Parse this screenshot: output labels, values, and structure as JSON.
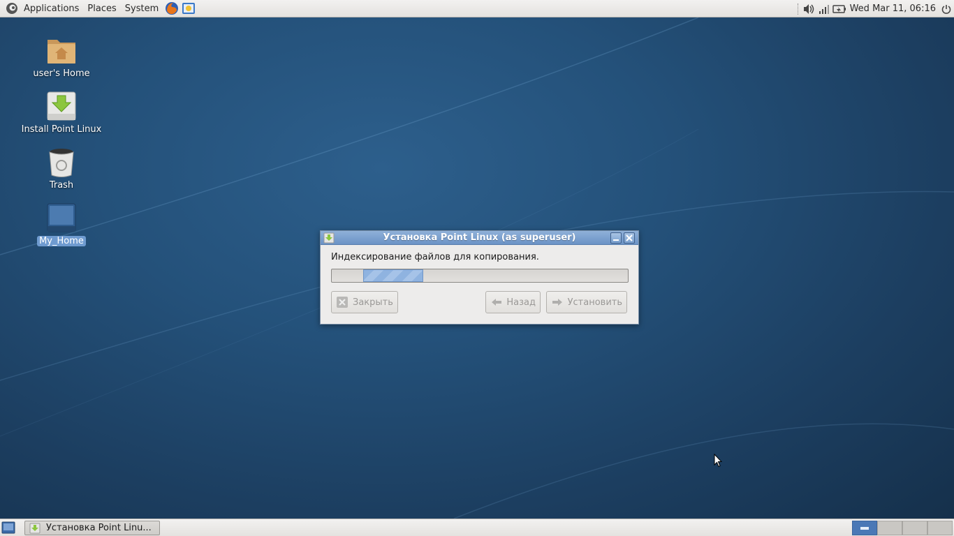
{
  "top_panel": {
    "menus": [
      "Applications",
      "Places",
      "System"
    ],
    "clock": "Wed Mar 11, 06:16"
  },
  "desktop_icons": [
    {
      "label": "user's Home",
      "icon": "home-folder-icon"
    },
    {
      "label": "Install Point Linux",
      "icon": "installer-icon"
    },
    {
      "label": "Trash",
      "icon": "trash-icon"
    },
    {
      "label": "My_Home",
      "icon": "computer-icon",
      "selected": true
    }
  ],
  "dialog": {
    "title": "Установка Point Linux (as superuser)",
    "message": "Индексирование файлов для копирования.",
    "buttons": {
      "close": "Закрыть",
      "back": "Назад",
      "install": "Установить"
    }
  },
  "taskbar": {
    "task_label": "Установка Point Linu..."
  },
  "colors": {
    "desktop": "#24517a",
    "titlebar": "#6b93c6",
    "selection": "#6f9bd0"
  }
}
